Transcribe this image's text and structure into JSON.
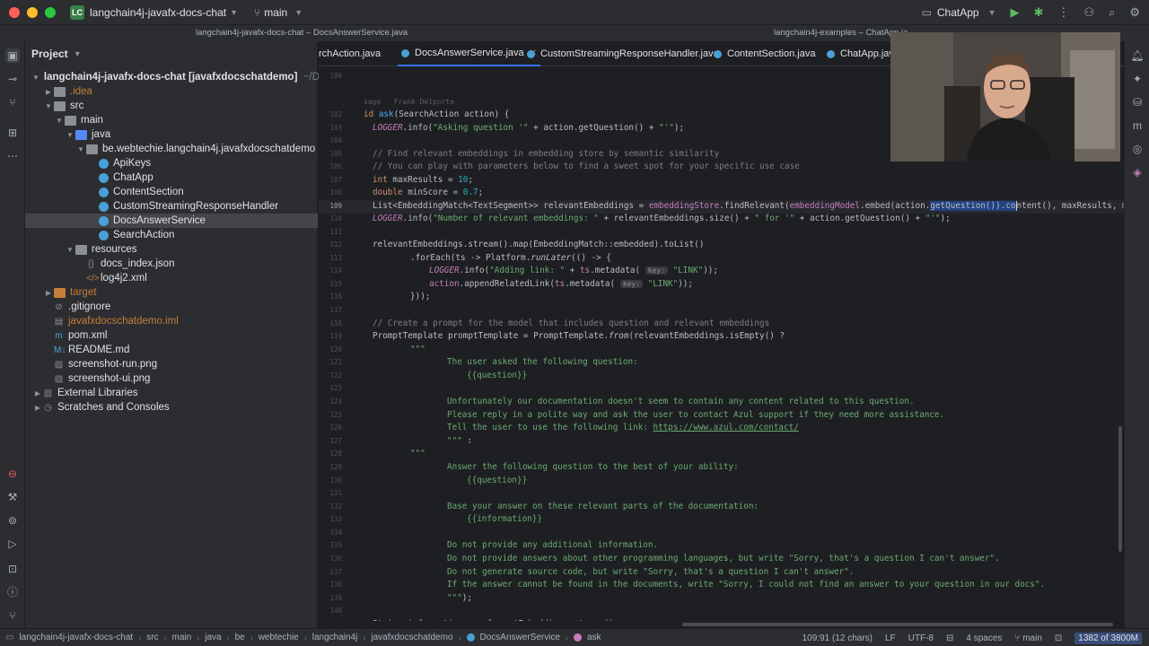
{
  "titlebar": {
    "project_badge": "LC",
    "project_name": "langchain4j-javafx-docs-chat",
    "branch": "main",
    "run_config": "ChatApp"
  },
  "window_titles": {
    "left": "langchain4j-javafx-docs-chat – DocsAnswerService.java",
    "right": "langchain4j-examples – ChatApp.ja"
  },
  "project_panel": {
    "title": "Project",
    "rows": [
      {
        "label": "langchain4j-javafx-docs-chat",
        "suffix": "[javafxdocschatdemo]",
        "path": "~/Documents/Gi"
      },
      {
        "label": ".idea"
      },
      {
        "label": "src"
      },
      {
        "label": "main"
      },
      {
        "label": "java"
      },
      {
        "label": "be.webtechie.langchain4j.javafxdocschatdemo"
      },
      {
        "label": "ApiKeys"
      },
      {
        "label": "ChatApp"
      },
      {
        "label": "ContentSection"
      },
      {
        "label": "CustomStreamingResponseHandler"
      },
      {
        "label": "DocsAnswerService"
      },
      {
        "label": "SearchAction"
      },
      {
        "label": "resources"
      },
      {
        "label": "docs_index.json"
      },
      {
        "label": "log4j2.xml"
      },
      {
        "label": "target"
      },
      {
        "label": ".gitignore"
      },
      {
        "label": "javafxdocschatdemo.iml"
      },
      {
        "label": "pom.xml"
      },
      {
        "label": "README.md"
      },
      {
        "label": "screenshot-run.png"
      },
      {
        "label": "screenshot-ui.png"
      },
      {
        "label": "External Libraries"
      },
      {
        "label": "Scratches and Consoles"
      }
    ]
  },
  "tabs": [
    {
      "label": "rchAction.java"
    },
    {
      "label": "DocsAnswerService.java"
    },
    {
      "label": "CustomStreamingResponseHandler.java"
    },
    {
      "label": "ContentSection.java"
    },
    {
      "label": "ChatApp.java"
    }
  ],
  "editor": {
    "blame_author": "Frank Delporte",
    "blame_prefix": "sage",
    "lines": [
      {
        "n": "100"
      },
      {
        "n": "101"
      },
      {
        "n": "102"
      },
      {
        "n": "103"
      },
      {
        "n": "104"
      },
      {
        "n": "105"
      },
      {
        "n": "106"
      },
      {
        "n": "107"
      },
      {
        "n": "108"
      },
      {
        "n": "109"
      },
      {
        "n": "110"
      },
      {
        "n": "111"
      },
      {
        "n": "112"
      },
      {
        "n": "113"
      },
      {
        "n": "114"
      },
      {
        "n": "115"
      },
      {
        "n": "116"
      },
      {
        "n": "117"
      },
      {
        "n": "118"
      },
      {
        "n": "119"
      },
      {
        "n": "120"
      },
      {
        "n": "121"
      },
      {
        "n": "122"
      },
      {
        "n": "123"
      },
      {
        "n": "124"
      },
      {
        "n": "125"
      },
      {
        "n": "126"
      },
      {
        "n": "127"
      },
      {
        "n": "128"
      },
      {
        "n": "129"
      },
      {
        "n": "130"
      },
      {
        "n": "131"
      },
      {
        "n": "132"
      },
      {
        "n": "133"
      },
      {
        "n": "134"
      },
      {
        "n": "135"
      },
      {
        "n": "136"
      },
      {
        "n": "137"
      },
      {
        "n": "138"
      },
      {
        "n": "139"
      },
      {
        "n": "140"
      },
      {
        "n": "141"
      }
    ]
  },
  "statusbar": {
    "crumbs": [
      "langchain4j-javafx-docs-chat",
      "src",
      "main",
      "java",
      "be",
      "webtechie",
      "langchain4j",
      "javafxdocschatdemo",
      "DocsAnswerService",
      "ask"
    ],
    "position": "109:91 (12 chars)",
    "line_sep": "LF",
    "encoding": "UTF-8",
    "indent": "4 spaces",
    "branch": "main",
    "memory": "1382 of 3800M"
  }
}
